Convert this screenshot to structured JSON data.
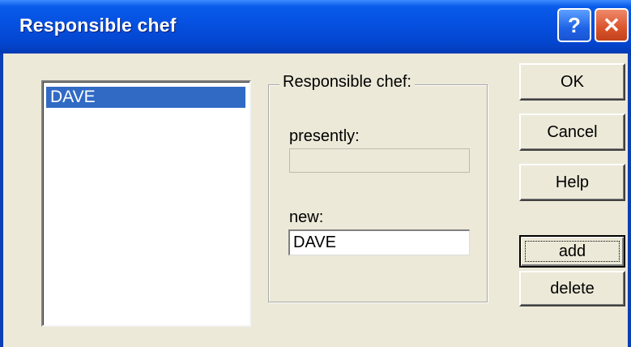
{
  "window": {
    "title": "Responsible chef",
    "help_glyph": "?",
    "close_glyph": "✕"
  },
  "list": {
    "items": [
      "DAVE"
    ],
    "selected_index": 0
  },
  "group": {
    "legend": "Responsible chef:",
    "presently_label": "presently:",
    "presently_value": "",
    "new_label": "new:",
    "new_value": "DAVE"
  },
  "buttons": {
    "ok": "OK",
    "cancel": "Cancel",
    "help": "Help",
    "add": "add",
    "delete": "delete"
  }
}
